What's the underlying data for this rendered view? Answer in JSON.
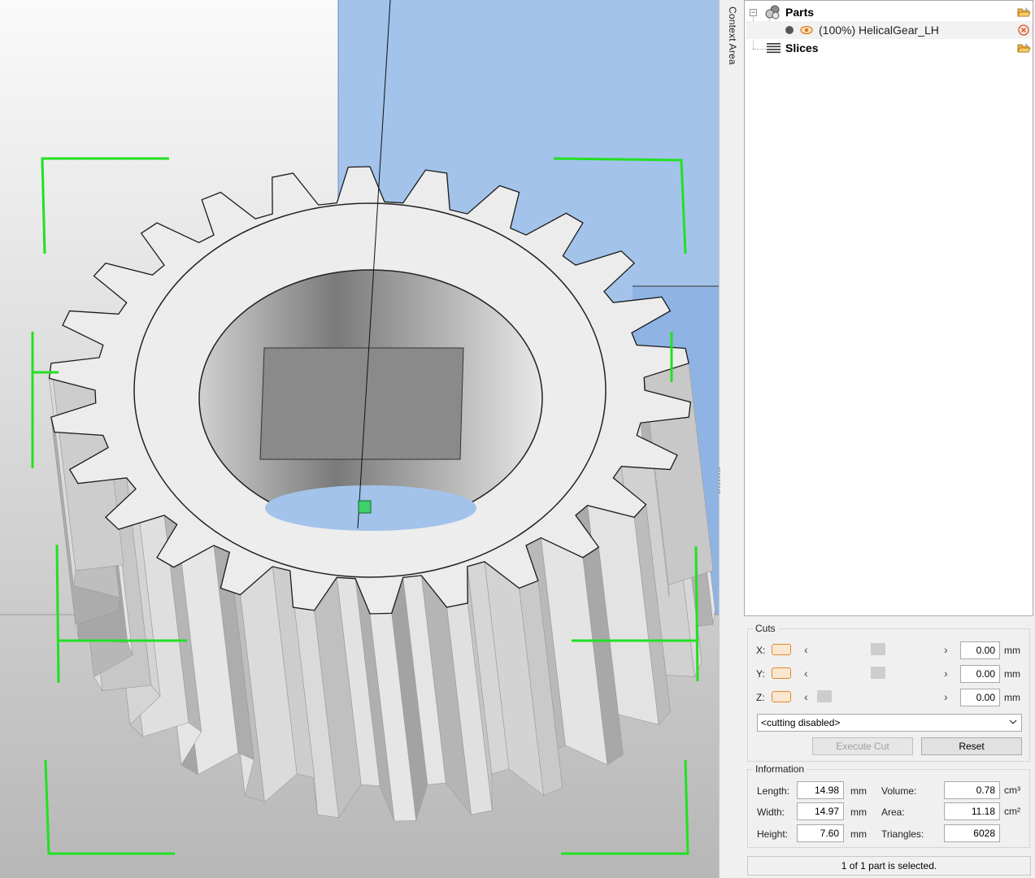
{
  "viewport": {
    "colors": {
      "background_top": "#f7f7f7",
      "background_bottom": "#b9b9b9",
      "plane_blue": "#a3c3ea",
      "gear_face": "#ececec",
      "gear_side": "#b8b8b8",
      "selection_green": "#22e022"
    }
  },
  "context_area": {
    "label": "Context Area"
  },
  "tree": {
    "parts": {
      "label": "Parts",
      "icon": "parts-icon",
      "action_icon": "folder-open-icon"
    },
    "part_item": {
      "label": "(100%) HelicalGear_LH",
      "icon": "eye-icon",
      "remove_icon": "remove-icon"
    },
    "slices": {
      "label": "Slices",
      "icon": "slices-icon",
      "action_icon": "folder-open-icon"
    }
  },
  "cuts": {
    "title": "Cuts",
    "axes": [
      {
        "label": "X:",
        "value": "0.00",
        "unit": "mm",
        "slider_fraction": 0.5
      },
      {
        "label": "Y:",
        "value": "0.00",
        "unit": "mm",
        "slider_fraction": 0.5
      },
      {
        "label": "Z:",
        "value": "0.00",
        "unit": "mm",
        "slider_fraction": 0.0
      }
    ],
    "mode_select": "<cutting disabled>",
    "execute_label": "Execute Cut",
    "reset_label": "Reset"
  },
  "information": {
    "title": "Information",
    "length_label": "Length:",
    "length_value": "14.98",
    "length_unit": "mm",
    "width_label": "Width:",
    "width_value": "14.97",
    "width_unit": "mm",
    "height_label": "Height:",
    "height_value": "7.60",
    "height_unit": "mm",
    "volume_label": "Volume:",
    "volume_value": "0.78",
    "volume_unit": "cm³",
    "area_label": "Area:",
    "area_value": "11.18",
    "area_unit": "cm²",
    "triangles_label": "Triangles:",
    "triangles_value": "6028"
  },
  "status": {
    "text": "1 of 1 part is selected."
  }
}
